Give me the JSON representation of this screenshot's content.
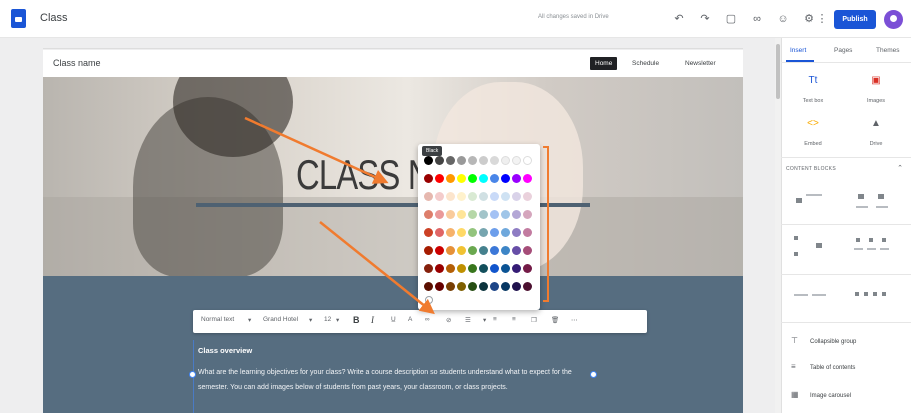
{
  "app": {
    "title": "Class",
    "save_status": "All changes saved in Drive",
    "publish_label": "Publish",
    "toolbar_icons": [
      "undo-icon",
      "redo-icon",
      "preview-icon",
      "link-icon",
      "add-editor-icon",
      "settings-icon",
      "more-vert-icon"
    ]
  },
  "site": {
    "name": "Class name",
    "nav": [
      {
        "label": "Home",
        "active": true
      },
      {
        "label": "Schedule",
        "active": false
      },
      {
        "label": "Newsletter",
        "active": false
      }
    ],
    "hero_title": "CLASS N"
  },
  "text_toolbar": {
    "style": "Normal text",
    "font": "Grand Hotel",
    "size": "12",
    "bold": "B",
    "italic": "I"
  },
  "color_palette": {
    "tooltip": "Black",
    "rows": [
      [
        "#000000",
        "#434343",
        "#666666",
        "#999999",
        "#b7b7b7",
        "#cccccc",
        "#d9d9d9",
        "#efefef",
        "#f3f3f3",
        "#ffffff"
      ],
      [
        "#980000",
        "#ff0000",
        "#ff9900",
        "#ffff00",
        "#00ff00",
        "#00ffff",
        "#4a86e8",
        "#0000ff",
        "#9900ff",
        "#ff00ff"
      ],
      [
        "#e6b8af",
        "#f4cccc",
        "#fce5cd",
        "#fff2cc",
        "#d9ead3",
        "#d0e0e3",
        "#c9daf8",
        "#cfe2f3",
        "#d9d2e9",
        "#ead1dc"
      ],
      [
        "#dd7e6b",
        "#ea9999",
        "#f9cb9c",
        "#ffe599",
        "#b6d7a8",
        "#a2c4c9",
        "#a4c2f4",
        "#9fc5e8",
        "#b4a7d6",
        "#d5a6bd"
      ],
      [
        "#cc4125",
        "#e06666",
        "#f6b26b",
        "#ffd966",
        "#93c47d",
        "#76a5af",
        "#6d9eeb",
        "#6fa8dc",
        "#8e7cc3",
        "#c27ba0"
      ],
      [
        "#a61c00",
        "#cc0000",
        "#e69138",
        "#f1c232",
        "#6aa84f",
        "#45818e",
        "#3c78d8",
        "#3d85c6",
        "#674ea7",
        "#a64d79"
      ],
      [
        "#85200c",
        "#990000",
        "#b45f06",
        "#bf9000",
        "#38761d",
        "#134f5c",
        "#1155cc",
        "#0b5394",
        "#351c75",
        "#741b47"
      ],
      [
        "#5b0f00",
        "#660000",
        "#783f04",
        "#7f6000",
        "#274e13",
        "#0c343d",
        "#1c4587",
        "#073763",
        "#20124d",
        "#4c1130"
      ]
    ]
  },
  "content": {
    "overview_title": "Class overview",
    "overview_body": "What are the learning objectives for your class? Write a course description so students understand what to expect for the semester. You can add images below of students from past years, your classroom, or class projects."
  },
  "panel": {
    "tabs": [
      {
        "label": "Insert",
        "active": true
      },
      {
        "label": "Pages",
        "active": false
      },
      {
        "label": "Themes",
        "active": false
      }
    ],
    "insert_items": [
      {
        "label": "Text box",
        "icon": "text-box-icon",
        "color": "#1a55d6"
      },
      {
        "label": "Images",
        "icon": "images-icon",
        "color": "#d93025"
      },
      {
        "label": "Embed",
        "icon": "embed-icon",
        "color": "#f9ab00"
      },
      {
        "label": "Drive",
        "icon": "drive-icon",
        "color": "#5f6368"
      }
    ],
    "layouts_heading": "CONTENT BLOCKS",
    "elements": [
      {
        "label": "Collapsible group",
        "icon": "collapsible-group-icon"
      },
      {
        "label": "Table of contents",
        "icon": "table-of-contents-icon"
      },
      {
        "label": "Image carousel",
        "icon": "image-carousel-icon"
      }
    ]
  },
  "colors": {
    "accent": "#1a55d6",
    "section_bg": "#566d80",
    "annotation": "#f07b2f"
  }
}
